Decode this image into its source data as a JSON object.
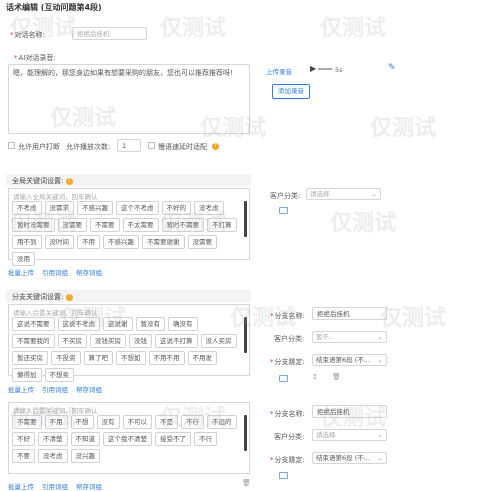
{
  "header": {
    "title": "话术编辑 (互动问题第4段)"
  },
  "form": {
    "name_label": "对话名称:",
    "name_value": "拒绝后挂机",
    "ai_label": "AI对话录音:",
    "ai_text": "嗯，能理解的，那您身边如果有想要采购的朋友，您也可以推荐推荐呀!",
    "upload_label": "上传录音",
    "play_duration": "5s",
    "add_recording_button": "添加录音",
    "allow_interrupt_label": "允许用户打断",
    "allow_replay_label": "允许播放次数:",
    "replay_count": "1",
    "delay_label": "慢语速延时适配"
  },
  "global_kw": {
    "section_title": "全局关键词设置:",
    "placeholder": "请输入全局关键词，回车确认",
    "tags": [
      "不考虑",
      "没需求",
      "不感兴趣",
      "这个不考虑",
      "不好的",
      "没考虑",
      "暂时没需要",
      "没需要",
      "不需要",
      "不太需要",
      "暂时不需要",
      "不打算",
      "用不到",
      "没时间",
      "不用",
      "不感兴趣",
      "不需要谢谢",
      "没需要",
      "没用"
    ],
    "customer_class_label": "客户分类:",
    "customer_class_placeholder": "请选择",
    "links": [
      "批量上传",
      "引用词组",
      "帮存词组"
    ]
  },
  "branch_section": {
    "section_title": "分支关键词设置:"
  },
  "branch1": {
    "placeholder": "请输入后置关键词，回车确认",
    "tags": [
      "这说不需要",
      "这说不考虑",
      "这说谢",
      "暂没有",
      "确没有",
      "不需要我的",
      "不买房",
      "没钱买房",
      "没钱",
      "这说不打算",
      "没人买房",
      "暂还买房",
      "不投资",
      "算了吧",
      "不想如",
      "不用不用",
      "不用发",
      "懒得加",
      "不想卖"
    ],
    "name_label": "分支名称:",
    "name_value": "拒绝后挂机",
    "class_label": "客户分类:",
    "class_value": "暂不...",
    "jump_label": "分支跳定:",
    "jump_value": "结束语第6段 (不...",
    "links": [
      "批量上传",
      "引用词组",
      "帮存词组"
    ]
  },
  "branch2": {
    "placeholder": "请输入后置关键词，回车确认",
    "tags": [
      "不需要",
      "不用",
      "不想",
      "没有",
      "不可以",
      "不是",
      "不行",
      "不远的",
      "不好",
      "不清楚",
      "不知道",
      "这个我不清楚",
      "接受不了",
      "不行",
      "不要",
      "没考虑",
      "没兴趣"
    ],
    "name_label": "分支名称:",
    "name_value": "拒绝后挂机",
    "class_label": "客户分类:",
    "class_value": "请选择",
    "jump_label": "分支跳定:",
    "jump_value": "结束语第6段 (不...",
    "links": [
      "批量上传",
      "引用词组",
      "帮存词组"
    ]
  },
  "watermark": "仅测试",
  "colors": {
    "accent": "#2f7de1",
    "warn": "#f5a623",
    "section_bg": "#f2f3f5"
  }
}
